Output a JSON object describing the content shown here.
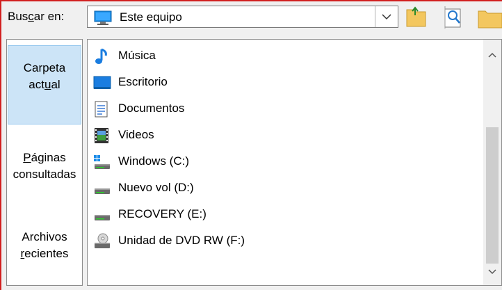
{
  "lookin": {
    "label_pre": "Bus",
    "label_acc": "c",
    "label_post": "ar en:",
    "value": "Este equipo"
  },
  "toolbar": {
    "up_icon": "up-folder-icon",
    "view_icon": "view-menu-icon",
    "new_folder_icon": "new-folder-icon"
  },
  "places": [
    {
      "line1": "Carpeta",
      "line2_pre": "act",
      "line2_acc": "u",
      "line2_post": "al",
      "active": true
    },
    {
      "line1_pre": "",
      "line1_acc": "P",
      "line1_post": "áginas",
      "line2": "consultadas",
      "active": false
    },
    {
      "line1": "Archivos",
      "line2_pre": "",
      "line2_acc": "r",
      "line2_post": "ecientes",
      "active": false
    }
  ],
  "files": [
    {
      "name": "Música",
      "icon": "music-icon"
    },
    {
      "name": "Escritorio",
      "icon": "desktop-icon"
    },
    {
      "name": "Documentos",
      "icon": "documents-icon"
    },
    {
      "name": "Videos",
      "icon": "videos-icon"
    },
    {
      "name": "Windows (C:)",
      "icon": "windows-drive-icon"
    },
    {
      "name": "Nuevo vol (D:)",
      "icon": "drive-icon"
    },
    {
      "name": "RECOVERY (E:)",
      "icon": "drive-icon"
    },
    {
      "name": "Unidad de DVD RW (F:)",
      "icon": "dvd-drive-icon"
    }
  ],
  "colors": {
    "accent_border": "#d22020",
    "selection": "#cce4f7",
    "folder": "#f3c75f"
  }
}
